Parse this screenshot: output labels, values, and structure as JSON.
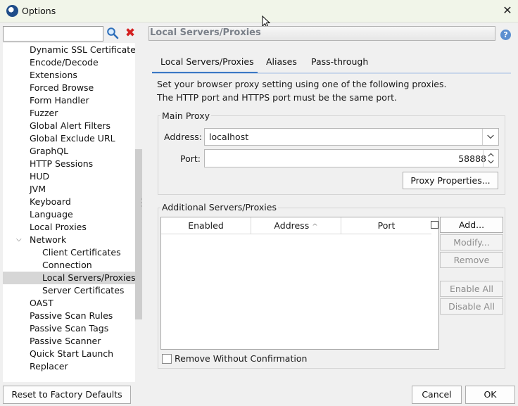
{
  "window": {
    "title": "Options"
  },
  "search": {
    "value": "",
    "placeholder": ""
  },
  "tree": {
    "items": [
      {
        "label": "Dynamic SSL Certificates",
        "level": 1
      },
      {
        "label": "Encode/Decode",
        "level": 1
      },
      {
        "label": "Extensions",
        "level": 1
      },
      {
        "label": "Forced Browse",
        "level": 1
      },
      {
        "label": "Form Handler",
        "level": 1
      },
      {
        "label": "Fuzzer",
        "level": 1
      },
      {
        "label": "Global Alert Filters",
        "level": 1
      },
      {
        "label": "Global Exclude URL",
        "level": 1
      },
      {
        "label": "GraphQL",
        "level": 1
      },
      {
        "label": "HTTP Sessions",
        "level": 1
      },
      {
        "label": "HUD",
        "level": 1
      },
      {
        "label": "JVM",
        "level": 1
      },
      {
        "label": "Keyboard",
        "level": 1
      },
      {
        "label": "Language",
        "level": 1
      },
      {
        "label": "Local Proxies",
        "level": 1
      },
      {
        "label": "Network",
        "level": 1,
        "expanded": true
      },
      {
        "label": "Client Certificates",
        "level": 2
      },
      {
        "label": "Connection",
        "level": 2
      },
      {
        "label": "Local Servers/Proxies",
        "level": 2,
        "selected": true
      },
      {
        "label": "Server Certificates",
        "level": 2
      },
      {
        "label": "OAST",
        "level": 1
      },
      {
        "label": "Passive Scan Rules",
        "level": 1
      },
      {
        "label": "Passive Scan Tags",
        "level": 1
      },
      {
        "label": "Passive Scanner",
        "level": 1
      },
      {
        "label": "Quick Start Launch",
        "level": 1
      },
      {
        "label": "Replacer",
        "level": 1
      }
    ]
  },
  "left_footer": {
    "reset_label": "Reset to Factory Defaults"
  },
  "panel": {
    "title": "Local Servers/Proxies",
    "tabs": [
      {
        "label": "Local Servers/Proxies",
        "active": true
      },
      {
        "label": "Aliases"
      },
      {
        "label": "Pass-through"
      }
    ],
    "description_line1": "Set your browser proxy setting using one of the following proxies.",
    "description_line2": "The HTTP port and HTTPS port must be the same port.",
    "main_proxy": {
      "title": "Main Proxy",
      "address_label": "Address:",
      "address_value": "localhost",
      "port_label": "Port:",
      "port_value": "58888",
      "properties_button": "Proxy Properties..."
    },
    "additional": {
      "title": "Additional Servers/Proxies",
      "columns": [
        "Enabled",
        "Address",
        "Port"
      ],
      "sort_indicator": "^",
      "rows": [],
      "buttons": {
        "add": "Add...",
        "modify": "Modify...",
        "remove": "Remove",
        "enable_all": "Enable All",
        "disable_all": "Disable All"
      },
      "remove_without_confirmation": {
        "label": "Remove Without Confirmation",
        "checked": false
      }
    }
  },
  "footer": {
    "cancel_label": "Cancel",
    "ok_label": "OK"
  },
  "colors": {
    "accent": "#3b78c4",
    "selection": "#d6d6d6",
    "titlebar": "#f1f5e9"
  }
}
